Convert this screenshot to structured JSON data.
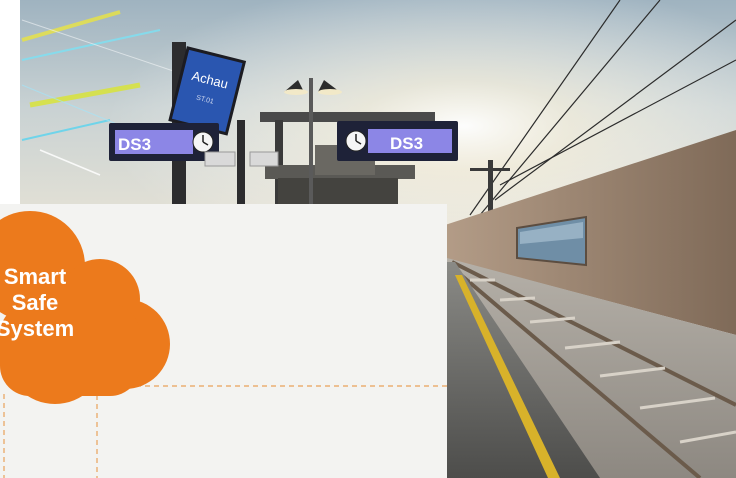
{
  "station_sign": {
    "name": "Achau",
    "sub": "ST.01"
  },
  "left_display": {
    "code": "DS3"
  },
  "right_display": {
    "code": "DS3"
  },
  "cloud_badge": {
    "lines": [
      "Smart",
      "Safe",
      "System"
    ]
  },
  "colors": {
    "accent_orange": "#ec7a1c",
    "sign_blue": "#2a56b0",
    "display_purple": "#8c86e6",
    "panel_bg": "#f3f3f1",
    "platform_line": "#d8b22a"
  },
  "icons": [
    "clock-icon",
    "cloud-shape"
  ]
}
